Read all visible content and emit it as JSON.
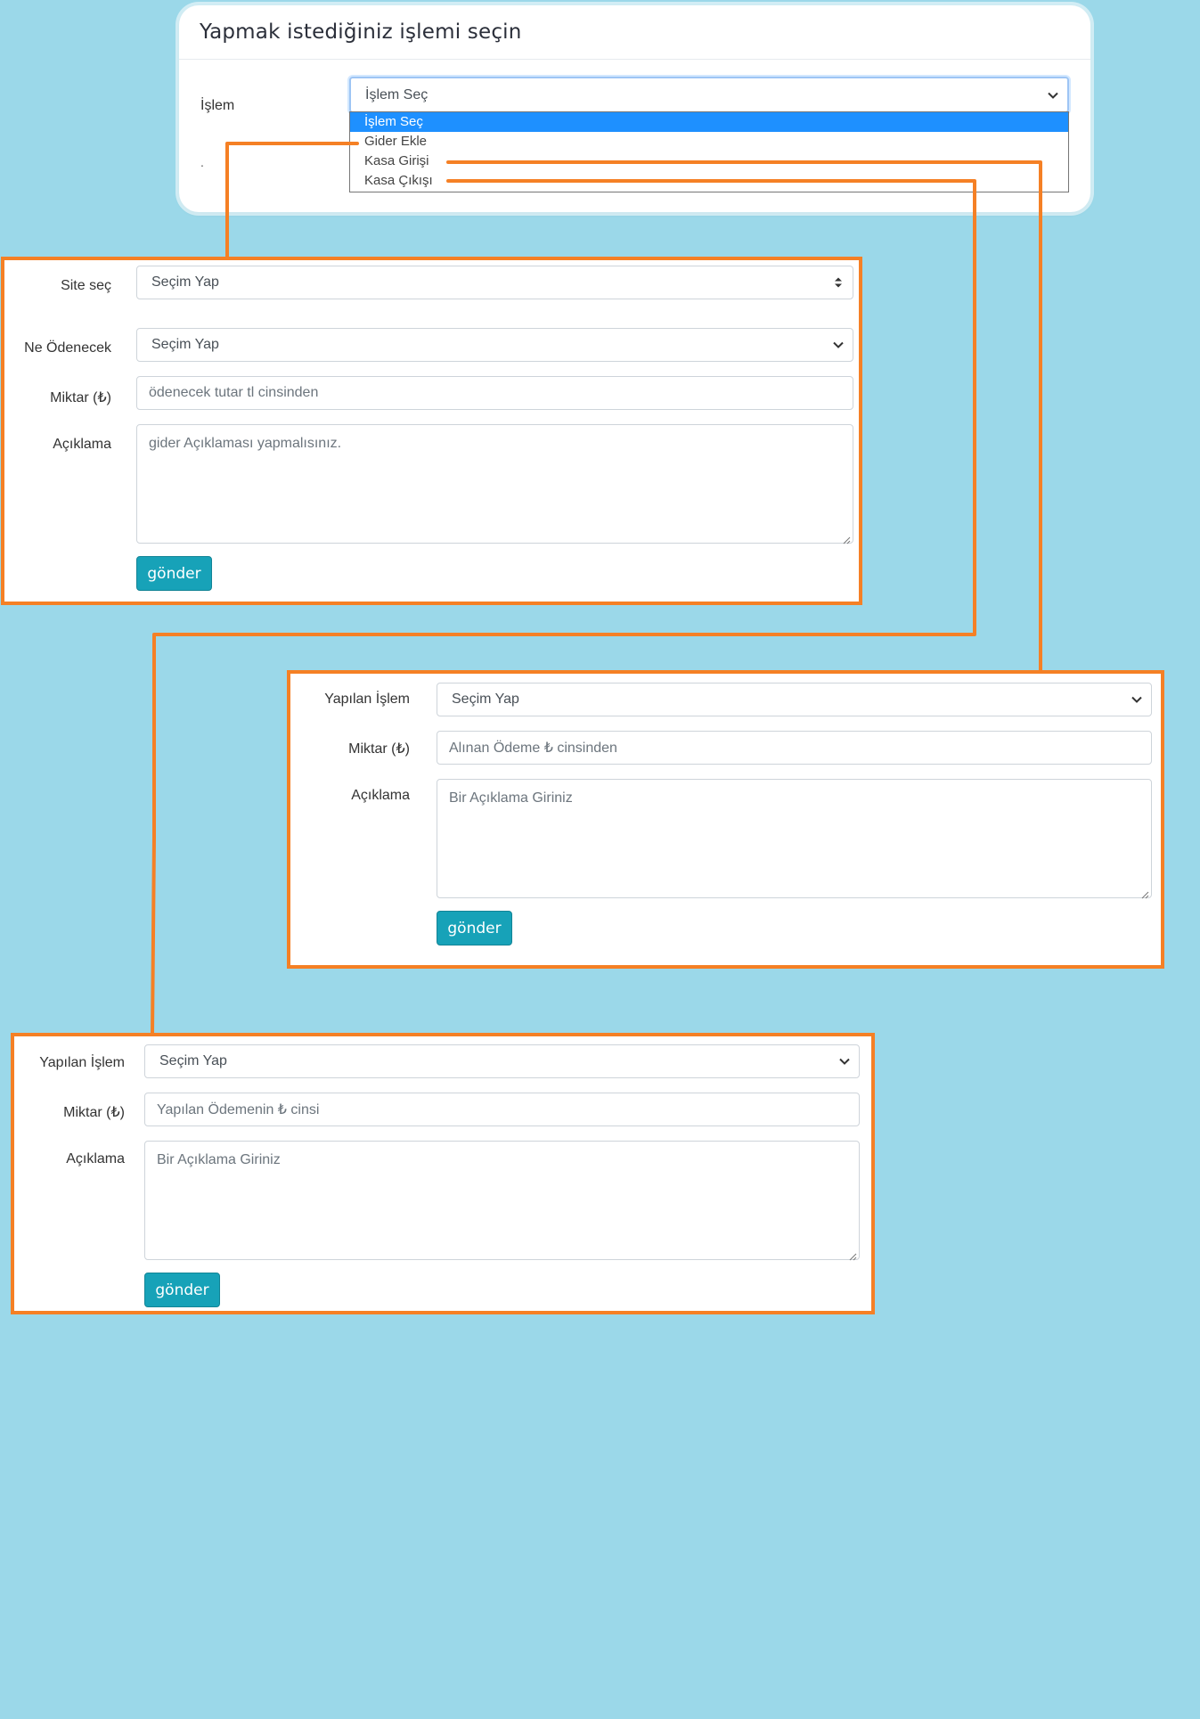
{
  "top_card": {
    "title": "Yapmak istediğiniz işlemi seçin",
    "label": "İşlem",
    "dot": ".",
    "select_value": "İşlem Seç",
    "options": [
      "İşlem Seç",
      "Gider Ekle",
      "Kasa Girişi",
      "Kasa Çıkışı"
    ],
    "active_option": "İşlem Seç"
  },
  "gider_form": {
    "site_label": "Site seç",
    "site_value": "Seçim Yap",
    "odenecek_label": "Ne Ödenecek",
    "odenecek_value": "Seçim Yap",
    "miktar_label": "Miktar (₺)",
    "miktar_placeholder": "ödenecek tutar tl cinsinden",
    "aciklama_label": "Açıklama",
    "aciklama_placeholder": "gider Açıklaması yapmalısınız.",
    "submit_label": "gönder"
  },
  "kasa_giris_form": {
    "islem_label": "Yapılan İşlem",
    "islem_value": "Seçim Yap",
    "miktar_label": "Miktar (₺)",
    "miktar_placeholder": "Alınan Ödeme ₺ cinsinden",
    "aciklama_label": "Açıklama",
    "aciklama_placeholder": "Bir Açıklama Giriniz",
    "submit_label": "gönder"
  },
  "kasa_cikis_form": {
    "islem_label": "Yapılan İşlem",
    "islem_value": "Seçim Yap",
    "miktar_label": "Miktar (₺)",
    "miktar_placeholder": "Yapılan Ödemenin ₺ cinsi",
    "aciklama_label": "Açıklama",
    "aciklama_placeholder": "Bir Açıklama Giriniz",
    "submit_label": "gönder"
  },
  "colors": {
    "background": "#9bd8e9",
    "accent_orange": "#f58025",
    "button": "#17a2b8",
    "dropdown_highlight": "#1e90ff"
  }
}
